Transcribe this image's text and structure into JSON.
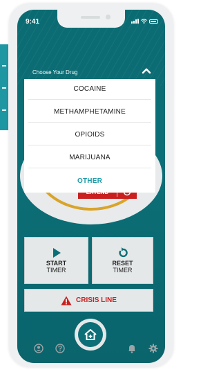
{
  "status_bar": {
    "time": "9:41"
  },
  "drug_selector": {
    "label": "Choose Your Drug",
    "options": [
      {
        "label": "COCAINE",
        "selected": false
      },
      {
        "label": "METHAMPHETAMINE",
        "selected": false
      },
      {
        "label": "OPIOIDS",
        "selected": false
      },
      {
        "label": "MARIJUANA",
        "selected": false
      },
      {
        "label": "OTHER",
        "selected": true
      }
    ]
  },
  "timer": {
    "extend_label": "EXTEND"
  },
  "actions": {
    "start": {
      "title": "START",
      "subtitle": "TIMER"
    },
    "reset": {
      "title": "RESET",
      "subtitle": "TIMER"
    },
    "crisis_line": "CRISIS LINE"
  },
  "colors": {
    "teal": "#0c6f77",
    "accent": "#1f9aa6",
    "alert_red": "#c9201f",
    "dial_ring": "#d9a42a"
  },
  "icons": {
    "chevron": "chevron-up-icon",
    "start": "play-icon",
    "reset": "reset-icon",
    "crisis": "warning-icon",
    "nav": [
      "profile-icon",
      "help-icon",
      "home-icon",
      "bell-icon",
      "gear-icon"
    ]
  }
}
